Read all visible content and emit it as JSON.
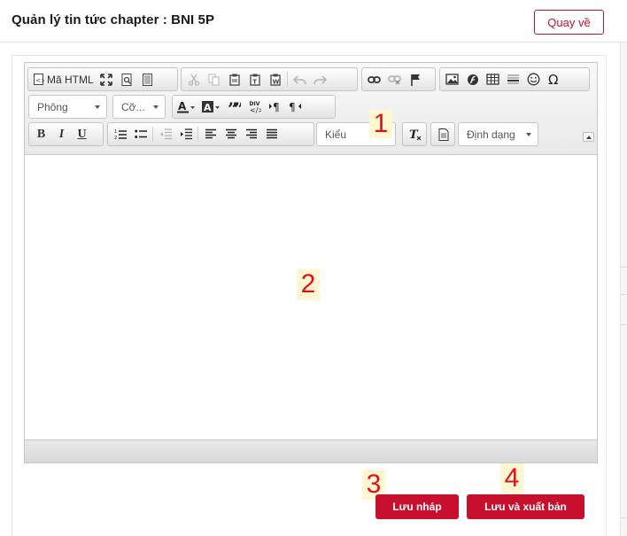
{
  "header": {
    "title": "Quản lý tin tức chapter : BNI 5P",
    "back_label": "Quay về"
  },
  "toolbar": {
    "source_label": "Mã HTML",
    "font_combo": "Phông",
    "size_combo": "Cỡ...",
    "style_combo": "Kiểu",
    "format_combo": "Định dạng"
  },
  "markers": {
    "m1": "1",
    "m2": "2",
    "m3": "3",
    "m4": "4"
  },
  "actions": {
    "draft_label": "Lưu nháp",
    "publish_label": "Lưu và xuất bản"
  },
  "colors": {
    "accent": "#c8102e",
    "marker_text": "#e0101a",
    "marker_bg": "#fff7d2"
  }
}
